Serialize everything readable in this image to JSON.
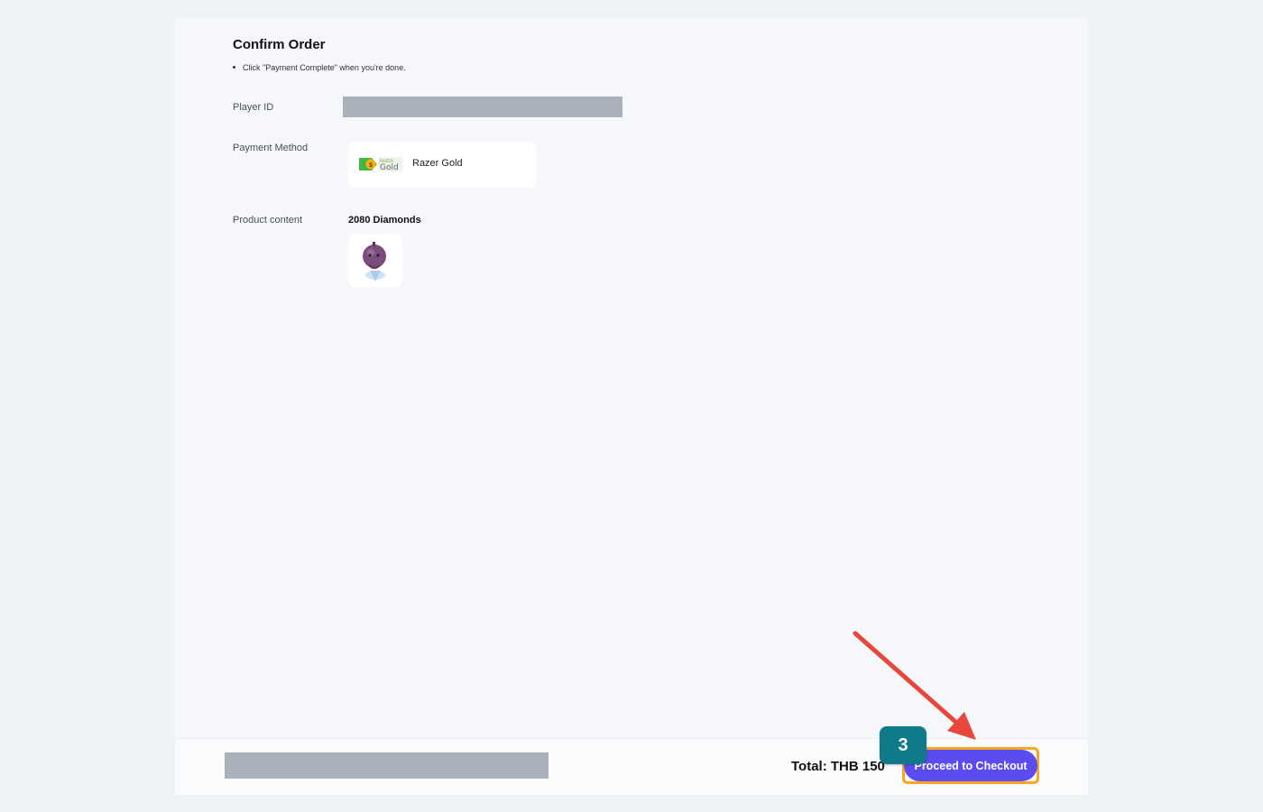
{
  "order": {
    "title": "Confirm Order",
    "instruction": "Click \"Payment Complete\" when you're done."
  },
  "player_id": {
    "label": "Player ID"
  },
  "payment": {
    "label": "Payment Method",
    "method_name": "Razer Gold",
    "logo_icon": "razer-gold-logo"
  },
  "product": {
    "label": "Product content",
    "name": "2080 Diamonds",
    "image_icon": "diamond-character-image"
  },
  "footer": {
    "total": "Total: THB 150",
    "checkout_label": "Proceed to Checkout"
  },
  "annotation": {
    "step_number": "3",
    "highlight_color": "#f5a623",
    "badge_color": "#0e7a8a",
    "arrow_color": "#e8473c"
  },
  "colors": {
    "button_bg": "#5b4cf0",
    "redacted": "#abb1ba"
  }
}
